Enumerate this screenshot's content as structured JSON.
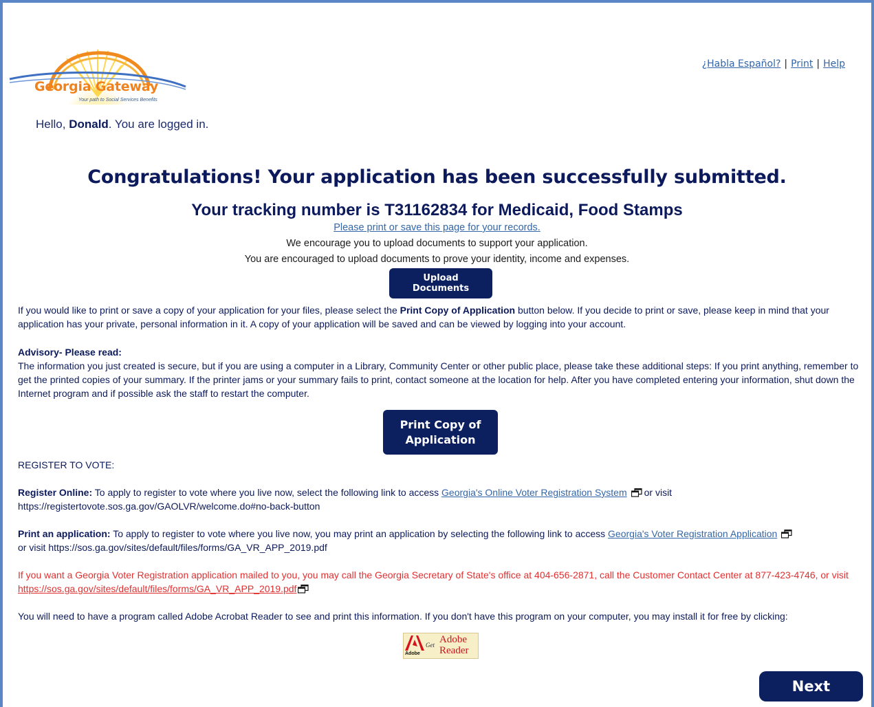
{
  "logo": {
    "name": "Georgia Gateway",
    "tagline": "Your path to Social Services Benefits"
  },
  "toplinks": {
    "spanish": "¿Habla Español?",
    "print": "Print",
    "help": "Help",
    "separator": "|"
  },
  "greeting": {
    "prefix": "Hello, ",
    "name": "Donald",
    "suffix": ". You are logged in."
  },
  "heading": "Congratulations! Your application has been successfully submitted.",
  "tracking": "Your tracking number is T31162834 for Medicaid, Food Stamps",
  "print_save_link": "Please print or save this page for your records.",
  "encourage_1": "We encourage you to upload documents to support your application.",
  "encourage_2": "You are encouraged to upload documents to prove your identity, income and expenses.",
  "upload_button": "Upload Documents",
  "copy_para": {
    "part1": "If you would like to print or save a copy of your application for your files, please select the ",
    "bold": "Print Copy of Application",
    "part2": " button below. If you decide to print or save, please keep in mind that your application has your private, personal information in it. A copy of your application will be saved and can be viewed by logging into your account."
  },
  "advisory": {
    "title": "Advisory- Please read:",
    "body": "The information you just created is secure, but if you are using a computer in a Library, Community Center or other public place, please take these additional steps: If you print anything, remember to get the printed copies of your summary. If the printer jams or your summary fails to print, contact someone at the location for help. After you have completed entering your information, shut down the Internet program and if possible ask the staff to restart the computer."
  },
  "print_copy_button": [
    "Print Copy of",
    "Application"
  ],
  "register_heading": "REGISTER TO VOTE:",
  "register_online": {
    "label": "Register Online:",
    "text": " To apply to register to vote where you live now, select the following link to access ",
    "link": "Georgia's Online Voter Registration System",
    "after": "or visit",
    "url": "https://registertovote.sos.ga.gov/GAOLVR/welcome.do#no-back-button"
  },
  "print_application": {
    "label": "Print an application:",
    "text": " To apply to register to vote where you live now, you may print an application by selecting the following link to access ",
    "link": "Georgia's Voter Registration Application",
    "after": "or visit https://sos.ga.gov/sites/default/files/forms/GA_VR_APP_2019.pdf"
  },
  "mailed": {
    "text": "If you want a Georgia Voter Registration application mailed to you, you may call the Georgia Secretary of State's office at 404-656-2871, call the Customer Contact Center at 877-423-4746, or visit ",
    "link": "https://sos.ga.gov/sites/default/files/forms/GA_VR_APP_2019.pdf"
  },
  "acrobat_text": "You will need to have a program called Adobe Acrobat Reader to see and print this information. If you don't have this program on your computer, you may install it for free by clicking:",
  "adobe_badge": {
    "small": "Adobe",
    "get": "Get",
    "line1": "Adobe",
    "line2": "Reader"
  },
  "next_button": "Next",
  "colors": {
    "navy": "#0c1a5c",
    "button": "#0c2060",
    "link": "#3366a8",
    "alert_red": "#e03030",
    "frame": "#5b86c6",
    "logo_orange": "#f0821e"
  }
}
